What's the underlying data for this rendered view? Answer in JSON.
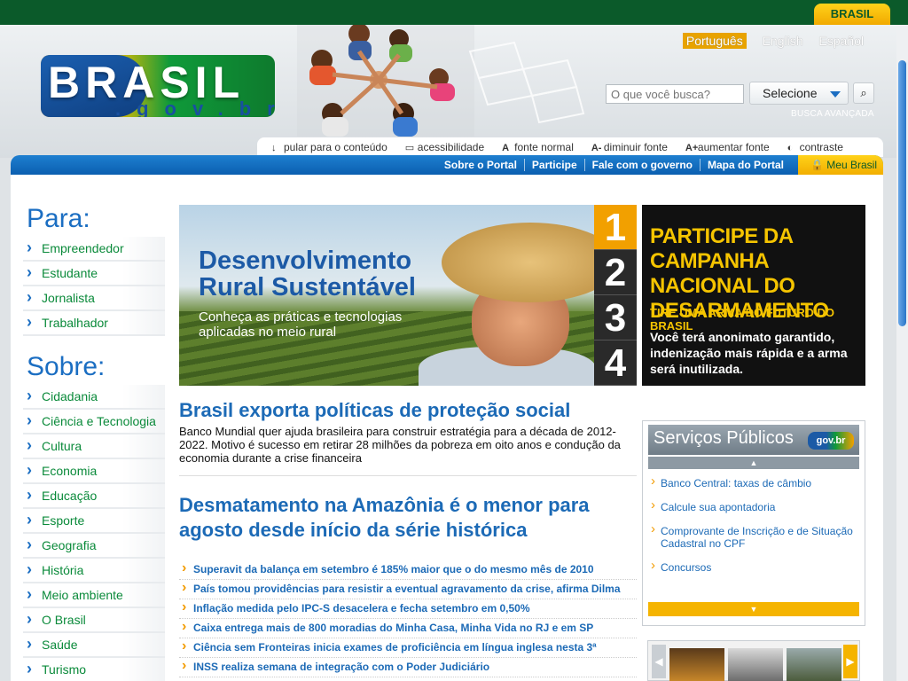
{
  "gov_badge": "BRASIL",
  "logo": {
    "main": "BRASIL",
    "sub": ".gov.br"
  },
  "languages": [
    "Português",
    "English",
    "Español"
  ],
  "search": {
    "placeholder": "O que você busca?",
    "select_label": "Selecione",
    "advanced": "BUSCA AVANÇADA"
  },
  "access_bar": [
    {
      "label": "pular para o conteúdo",
      "icon": "arrow-down-icon"
    },
    {
      "label": "acessibilidade",
      "icon": "monitor-icon"
    },
    {
      "label": "fonte normal",
      "icon": "font-icon"
    },
    {
      "label": "diminuir fonte",
      "icon": "font-decrease-icon"
    },
    {
      "label": "aumentar fonte",
      "icon": "font-increase-icon"
    },
    {
      "label": "contraste",
      "icon": "contrast-icon"
    }
  ],
  "nav": {
    "links": [
      "Sobre o Portal",
      "Participe",
      "Fale com o governo",
      "Mapa do Portal"
    ],
    "meu_brasil": "Meu Brasil"
  },
  "sidebar": {
    "para_title": "Para:",
    "para_items": [
      "Empreendedor",
      "Estudante",
      "Jornalista",
      "Trabalhador"
    ],
    "sobre_title": "Sobre:",
    "sobre_items": [
      "Cidadania",
      "Ciência e Tecnologia",
      "Cultura",
      "Economia",
      "Educação",
      "Esporte",
      "Geografia",
      "História",
      "Meio ambiente",
      "O Brasil",
      "Saúde",
      "Turismo"
    ]
  },
  "banner": {
    "title": "Desenvolvimento Rural Sustentável",
    "subtitle": "Conheça as práticas e tecnologias aplicadas no meio rural",
    "numbers": [
      "1",
      "2",
      "3",
      "4"
    ],
    "active_index": 0
  },
  "campaign": {
    "title": "PARTICIPE DA CAMPANHA NACIONAL DO DESARMAMENTO",
    "tagline": "TIRE UMA ARMA DO FUTURO DO BRASIL",
    "text": "Você terá anonimato garantido, indenização mais rápida e a arma será inutilizada."
  },
  "news": {
    "lead1_title": "Brasil exporta políticas de proteção social",
    "lead1_text": "Banco Mundial quer ajuda brasileira para construir estratégia para a década de 2012-2022. Motivo é sucesso em retirar 28 milhões da pobreza em oito anos e condução da economia durante a crise financeira",
    "lead2_title": "Desmatamento na Amazônia é o menor para agosto desde início da série histórica",
    "headlines": [
      "Superavit da balança em setembro é 185% maior que o do mesmo mês de 2010",
      "País tomou providências para resistir a eventual agravamento da crise, afirma Dilma",
      "Inflação medida pelo IPC-S desacelera e fecha setembro em 0,50%",
      "Caixa entrega mais de 800 moradias do Minha Casa, Minha Vida no RJ e em SP",
      "Ciência sem Fronteiras inicia exames de proficiência em língua inglesa nesta 3ª",
      "INSS realiza semana de integração com o Poder Judiciário"
    ]
  },
  "services": {
    "title": "Serviços Públicos",
    "logo_text": "gov.br",
    "items": [
      "Banco Central: taxas de câmbio",
      "Calcule sua apontadoria",
      "Comprovante de Inscrição e de Situação Cadastral no CPF",
      "Concursos"
    ]
  },
  "colors": {
    "gov_green": "#0b5a2a",
    "brand_blue": "#1c6ab6",
    "accent_yellow": "#f2a000",
    "link_green": "#0a8a3a"
  }
}
